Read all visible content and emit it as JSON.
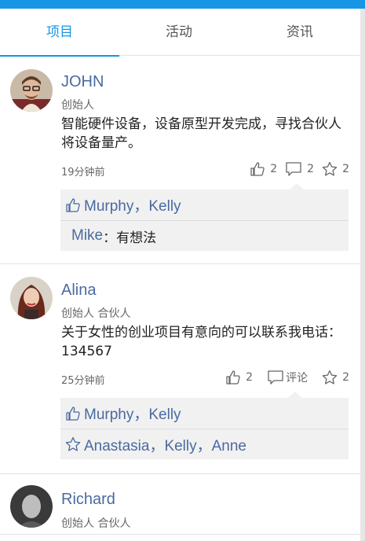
{
  "colors": {
    "accent": "#1597e5",
    "name": "#4a6aa0"
  },
  "tabs": [
    {
      "label": "项目"
    },
    {
      "label": "活动"
    },
    {
      "label": "资讯"
    }
  ],
  "posts": [
    {
      "name": "JOHN",
      "role": "创始人",
      "content": "智能硬件设备，设备原型开发完成，寻找合伙人将设备量产。",
      "time": "19分钟前",
      "likes": "2",
      "comments": "2",
      "stars": "2",
      "liked_by": "Murphy，Kelly",
      "comment_author": "Mike",
      "comment_text": "：有想法"
    },
    {
      "name": "Alina",
      "role": "创始人 合伙人",
      "content": "关于女性的创业项目有意向的可以联系我电话：134567",
      "time": "25分钟前",
      "likes": "2",
      "comment_label": "评论",
      "stars": "2",
      "liked_by": "Murphy，Kelly",
      "starred_by": "Anastasia，Kelly，Anne"
    },
    {
      "name": "Richard",
      "role": "创始人 合伙人"
    }
  ]
}
